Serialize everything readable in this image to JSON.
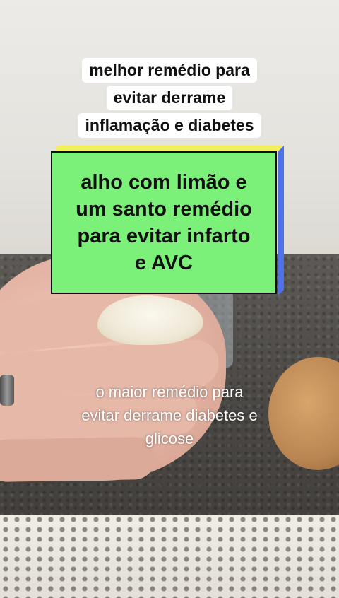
{
  "top_caption": {
    "lines": [
      "melhor remédio para",
      "evitar derrame",
      "inflamação e diabetes"
    ]
  },
  "banner": {
    "lines": [
      "alho com limão e",
      "um santo remédio",
      "para evitar infarto",
      "e AVC"
    ],
    "colors": {
      "fill": "#7cf17a",
      "top_edge": "#f3ef5a",
      "side_edge": "#4f73e6"
    }
  },
  "bottom_caption": {
    "lines": [
      "o maior remédio para",
      "evitar derrame diabetes e",
      "glicose"
    ]
  }
}
